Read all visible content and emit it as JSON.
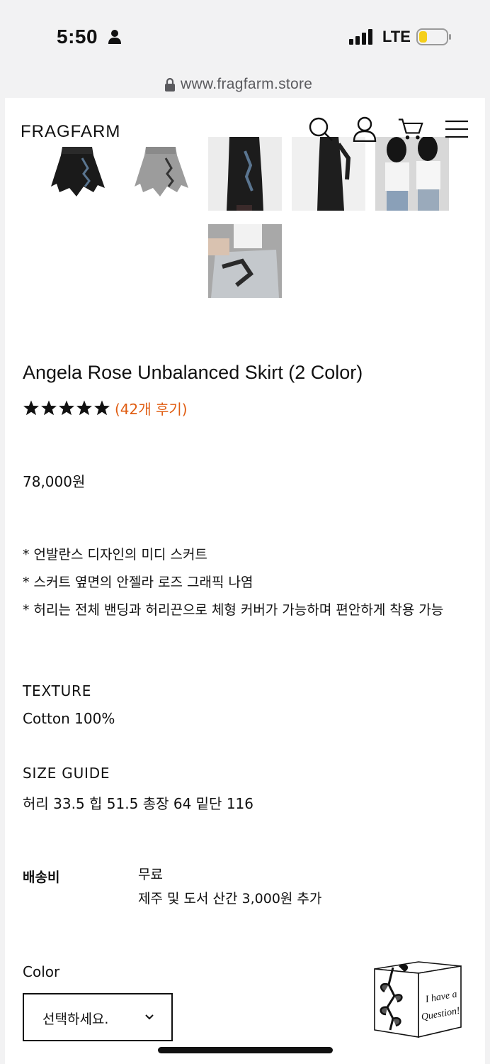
{
  "status_bar": {
    "time": "5:50",
    "network": "LTE"
  },
  "browser": {
    "url": "www.fragfarm.store"
  },
  "header": {
    "logo": "FRAGFARM"
  },
  "product": {
    "title": "Angela Rose Unbalanced Skirt (2 Color)",
    "rating": 5,
    "reviews": "(42개 후기)",
    "price": "78,000원",
    "description": [
      "* 언발란스 디자인의 미디 스커트",
      "* 스커트 옆면의 안젤라 로즈 그래픽 나염",
      "* 허리는 전체 밴딩과 허리끈으로 체형 커버가 가능하며 편안하게 착용 가능"
    ],
    "texture_label": "TEXTURE",
    "texture_value": "Cotton 100%",
    "size_label": "SIZE GUIDE",
    "size_value": "허리 33.5 힙 51.5 총장 64 밑단 116"
  },
  "shipping": {
    "label": "배송비",
    "value": "무료",
    "note": "제주 및 도서 산간 3,000원 추가"
  },
  "option": {
    "label": "Color",
    "selected": "선택하세요."
  },
  "question_box": {
    "line1": "I have a",
    "line2": "Question!"
  },
  "colors": {
    "review_accent": "#e05d12",
    "text": "#111111"
  }
}
